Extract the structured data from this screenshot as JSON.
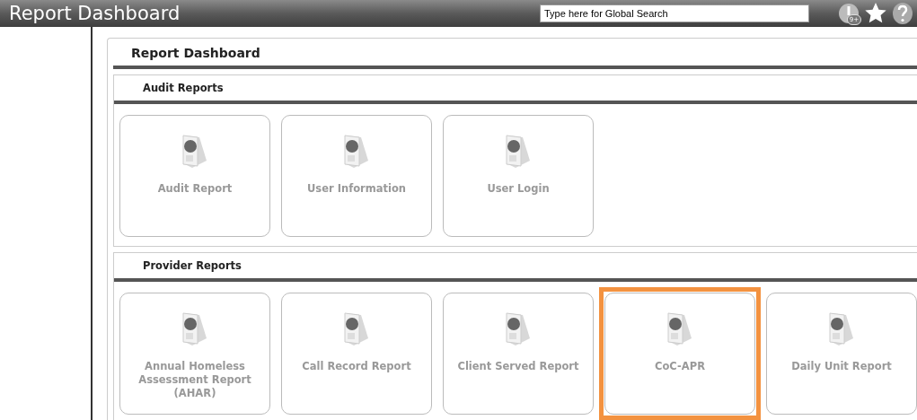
{
  "header": {
    "title": "Report Dashboard",
    "search": {
      "placeholder": "Type here for Global Search"
    },
    "notification_badge": "9+"
  },
  "panel": {
    "title": "Report Dashboard",
    "sections": [
      {
        "title": "Audit Reports",
        "tiles": [
          {
            "label": "Audit Report",
            "highlighted": false
          },
          {
            "label": "User Information",
            "highlighted": false
          },
          {
            "label": "User Login",
            "highlighted": false
          }
        ]
      },
      {
        "title": "Provider Reports",
        "tiles": [
          {
            "label": "Annual Homeless Assessment Report (AHAR)",
            "highlighted": false
          },
          {
            "label": "Call Record Report",
            "highlighted": false
          },
          {
            "label": "Client Served Report",
            "highlighted": false
          },
          {
            "label": "CoC-APR",
            "highlighted": true
          },
          {
            "label": "Daily Unit Report",
            "highlighted": false
          }
        ]
      }
    ]
  }
}
